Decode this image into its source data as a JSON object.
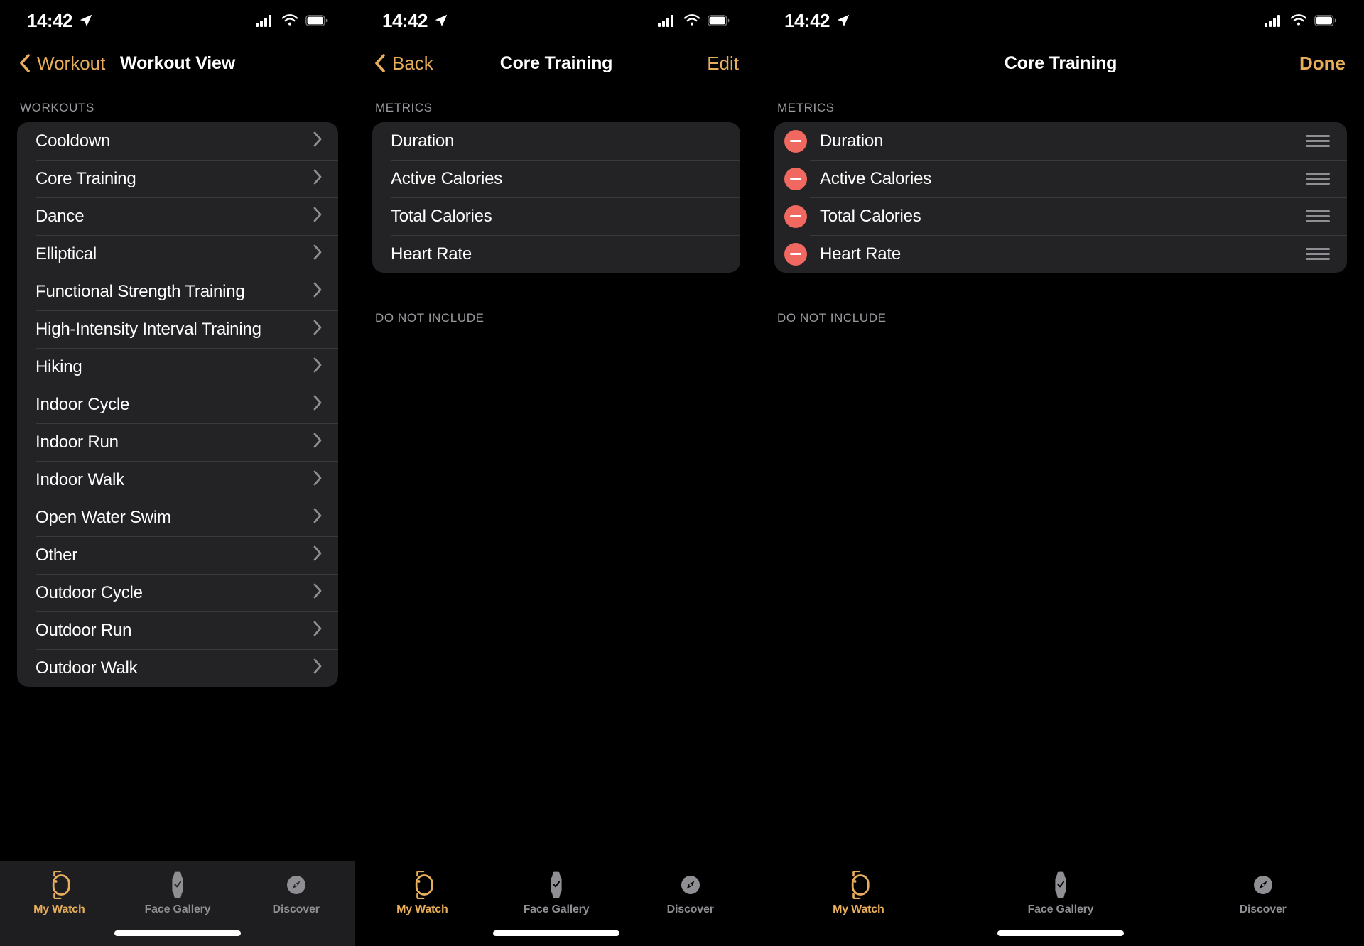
{
  "status_bar": {
    "time": "14:42",
    "location_icon": "location-arrow-icon",
    "cellular_icon": "cellular-signal-icon",
    "wifi_icon": "wifi-icon",
    "battery_icon": "battery-icon"
  },
  "colors": {
    "accent": "#E8AE5B",
    "destructive": "#F0685F",
    "card_bg": "#232325",
    "separator": "#3A3A3C",
    "secondary_text": "#8E8E93",
    "screen_bg": "#000000"
  },
  "panel1": {
    "nav": {
      "back_label": "Workout",
      "back_icon": "chevron-left-icon",
      "title": "Workout View"
    },
    "section_header": "WORKOUTS",
    "items": [
      {
        "label": "Cooldown",
        "accessory": "chevron-right-icon"
      },
      {
        "label": "Core Training",
        "accessory": "chevron-right-icon"
      },
      {
        "label": "Dance",
        "accessory": "chevron-right-icon"
      },
      {
        "label": "Elliptical",
        "accessory": "chevron-right-icon"
      },
      {
        "label": "Functional Strength Training",
        "accessory": "chevron-right-icon"
      },
      {
        "label": "High-Intensity Interval Training",
        "accessory": "chevron-right-icon"
      },
      {
        "label": "Hiking",
        "accessory": "chevron-right-icon"
      },
      {
        "label": "Indoor Cycle",
        "accessory": "chevron-right-icon"
      },
      {
        "label": "Indoor Run",
        "accessory": "chevron-right-icon"
      },
      {
        "label": "Indoor Walk",
        "accessory": "chevron-right-icon"
      },
      {
        "label": "Open Water Swim",
        "accessory": "chevron-right-icon"
      },
      {
        "label": "Other",
        "accessory": "chevron-right-icon"
      },
      {
        "label": "Outdoor Cycle",
        "accessory": "chevron-right-icon"
      },
      {
        "label": "Outdoor Run",
        "accessory": "chevron-right-icon"
      },
      {
        "label": "Outdoor Walk",
        "accessory": "chevron-right-icon"
      }
    ],
    "tabs": [
      {
        "label": "My Watch",
        "icon": "watch-icon",
        "active": true
      },
      {
        "label": "Face Gallery",
        "icon": "watch-face-icon",
        "active": false
      },
      {
        "label": "Discover",
        "icon": "compass-icon",
        "active": false
      }
    ]
  },
  "panel2": {
    "nav": {
      "back_label": "Back",
      "back_icon": "chevron-left-icon",
      "title": "Core Training",
      "action_label": "Edit"
    },
    "section_header": "METRICS",
    "metrics": [
      {
        "label": "Duration"
      },
      {
        "label": "Active Calories"
      },
      {
        "label": "Total Calories"
      },
      {
        "label": "Heart Rate"
      }
    ],
    "excluded_header": "DO NOT INCLUDE",
    "excluded_items": [],
    "tabs": [
      {
        "label": "My Watch",
        "icon": "watch-icon",
        "active": true
      },
      {
        "label": "Face Gallery",
        "icon": "watch-face-icon",
        "active": false
      },
      {
        "label": "Discover",
        "icon": "compass-icon",
        "active": false
      }
    ]
  },
  "panel3": {
    "nav": {
      "title": "Core Training",
      "action_label": "Done"
    },
    "section_header": "METRICS",
    "metrics": [
      {
        "label": "Duration",
        "remove_icon": "minus-circle-icon",
        "reorder_icon": "reorder-grip-icon"
      },
      {
        "label": "Active Calories",
        "remove_icon": "minus-circle-icon",
        "reorder_icon": "reorder-grip-icon"
      },
      {
        "label": "Total Calories",
        "remove_icon": "minus-circle-icon",
        "reorder_icon": "reorder-grip-icon"
      },
      {
        "label": "Heart Rate",
        "remove_icon": "minus-circle-icon",
        "reorder_icon": "reorder-grip-icon"
      }
    ],
    "excluded_header": "DO NOT INCLUDE",
    "excluded_items": [],
    "tabs": [
      {
        "label": "My Watch",
        "icon": "watch-icon",
        "active": true
      },
      {
        "label": "Face Gallery",
        "icon": "watch-face-icon",
        "active": false
      },
      {
        "label": "Discover",
        "icon": "compass-icon",
        "active": false
      }
    ]
  }
}
